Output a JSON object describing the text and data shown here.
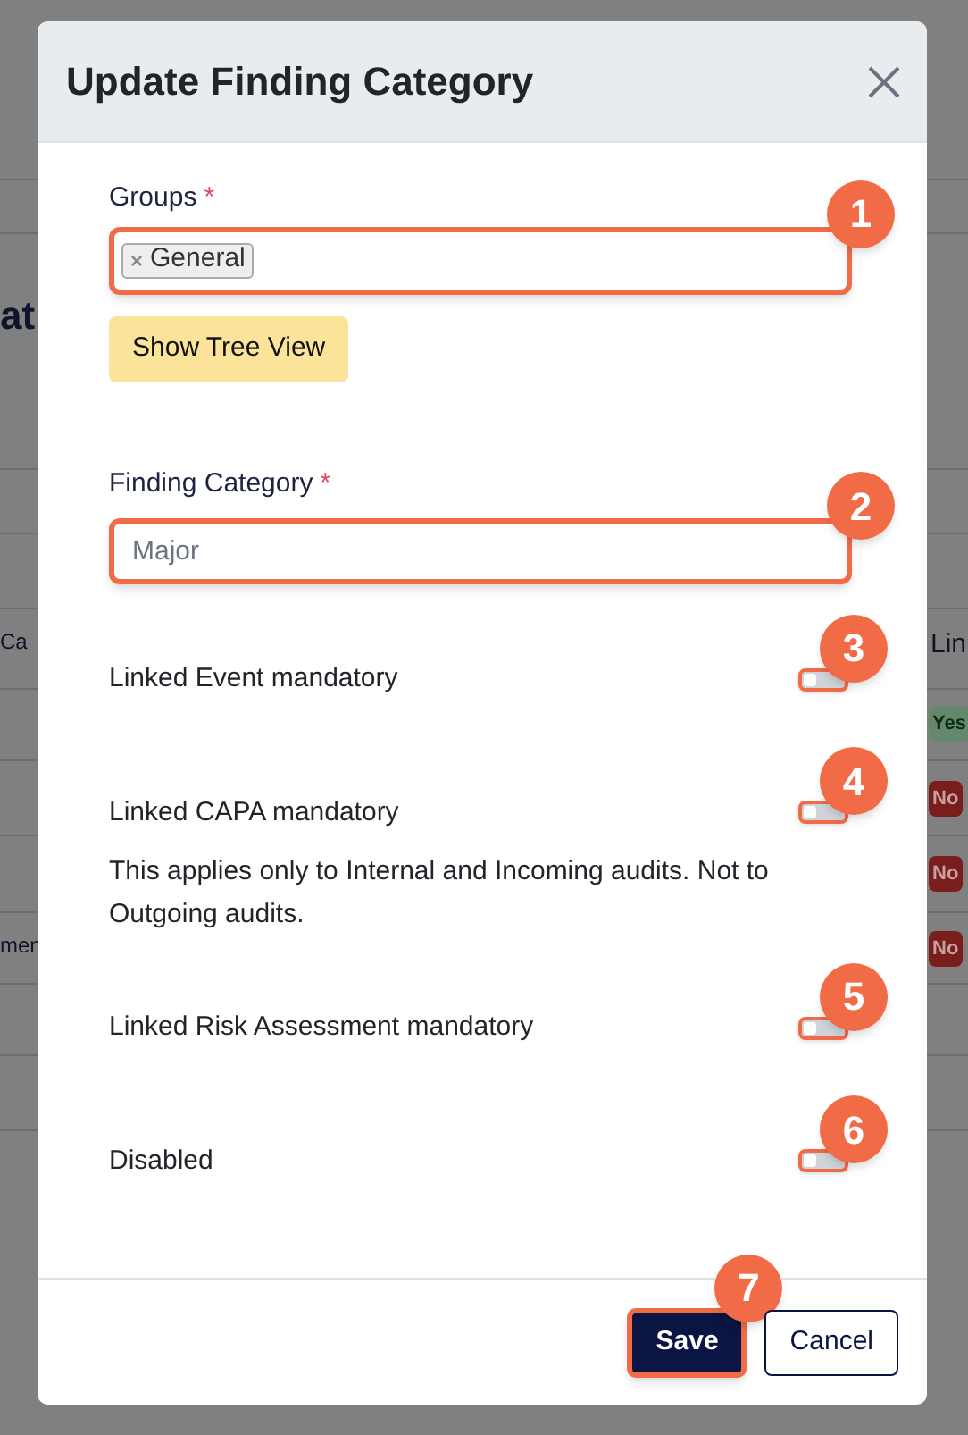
{
  "background_page": {
    "left_fragments": [
      {
        "text": "at",
        "kind": "heading"
      },
      {
        "text": "Ca",
        "kind": "text"
      },
      {
        "text": "men",
        "kind": "text"
      }
    ],
    "right_fragments": [
      {
        "text": "Lin",
        "kind": "text"
      },
      {
        "text": "Yes",
        "kind": "badge",
        "color": "#64886c"
      },
      {
        "text": "No",
        "kind": "badge",
        "color": "#7a1d1d"
      },
      {
        "text": "No",
        "kind": "badge",
        "color": "#7a1d1d"
      },
      {
        "text": "No",
        "kind": "badge",
        "color": "#7a1d1d"
      }
    ]
  },
  "window": {
    "title": "Update Finding Category"
  },
  "groups_field": {
    "label": "Groups",
    "required_mark": "*",
    "tags": [
      {
        "label": "General",
        "remove": "×"
      }
    ],
    "callout": "1"
  },
  "show_tree_button": "Show Tree View",
  "category_field": {
    "label": "Finding Category",
    "required_mark": "*",
    "placeholder": "Major",
    "callout": "2"
  },
  "toggles": [
    {
      "label": "Linked Event mandatory",
      "on": false,
      "callout": "3"
    },
    {
      "label": "Linked CAPA mandatory",
      "on": false,
      "callout": "4",
      "note": "This applies only to Internal and Incoming audits. Not to Outgoing audits."
    },
    {
      "label": "Linked Risk Assessment mandatory",
      "on": false,
      "callout": "5"
    },
    {
      "label": "Disabled",
      "on": false,
      "callout": "6"
    }
  ],
  "buttons": [
    {
      "label": "Save",
      "kind": "primary",
      "callout": "7"
    },
    {
      "label": "Cancel",
      "kind": "secondary"
    }
  ]
}
